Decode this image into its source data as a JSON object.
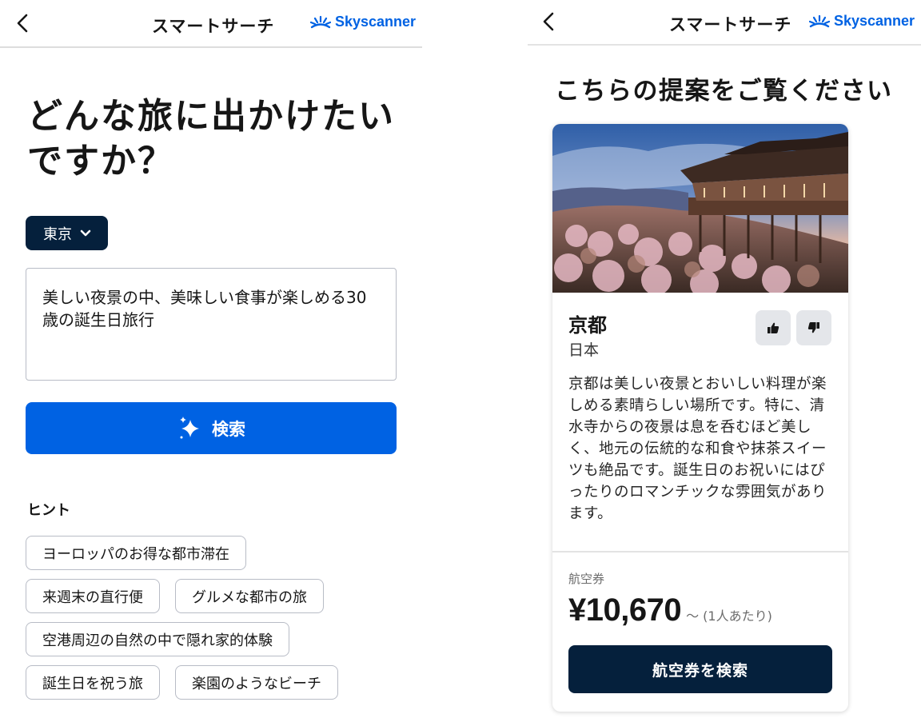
{
  "left_screen": {
    "header": {
      "back_icon": "chevron-left-icon",
      "title": "スマートサーチ",
      "brand": "Skyscanner",
      "brand_color": "#0062e3"
    },
    "heading": "どんな旅に出かけたいですか？",
    "origin": {
      "value": "東京",
      "icon": "chevron-down-icon"
    },
    "query": {
      "value": "美しい夜景の中、美味しい食事が楽しめる30歳の誕生日旅行"
    },
    "search_button": {
      "label": "検索",
      "icon": "sparkle-icon",
      "color": "#0062e3"
    },
    "hints": {
      "label": "ヒント",
      "items": [
        "ヨーロッパのお得な都市滞在",
        "来週末の直行便",
        "グルメな都市の旅",
        "空港周辺の自然の中で隠れ家的体験",
        "誕生日を祝う旅",
        "楽園のようなビーチ"
      ]
    }
  },
  "right_screen": {
    "header": {
      "back_icon": "chevron-left-icon",
      "title": "スマートサーチ",
      "brand": "Skyscanner"
    },
    "heading": "こちらの提案をご覧ください",
    "card": {
      "image": "kyoto-temple-photo",
      "city": "京都",
      "country": "日本",
      "like_icon": "thumbs-up-icon",
      "dislike_icon": "thumbs-down-icon",
      "description": "京都は美しい夜景とおいしい料理が楽しめる素晴らしい場所です。特に、清水寺からの夜景は息を呑むほど美しく、地元の伝統的な和食や抹茶スイーツも絶品です。誕生日のお祝いにはぴったりのロマンチックな雰囲気があります。",
      "price_label": "航空券",
      "price": "¥10,670",
      "price_suffix": "～ (1人あたり)",
      "button_label": "航空券を検索",
      "button_color": "#05203c"
    }
  }
}
